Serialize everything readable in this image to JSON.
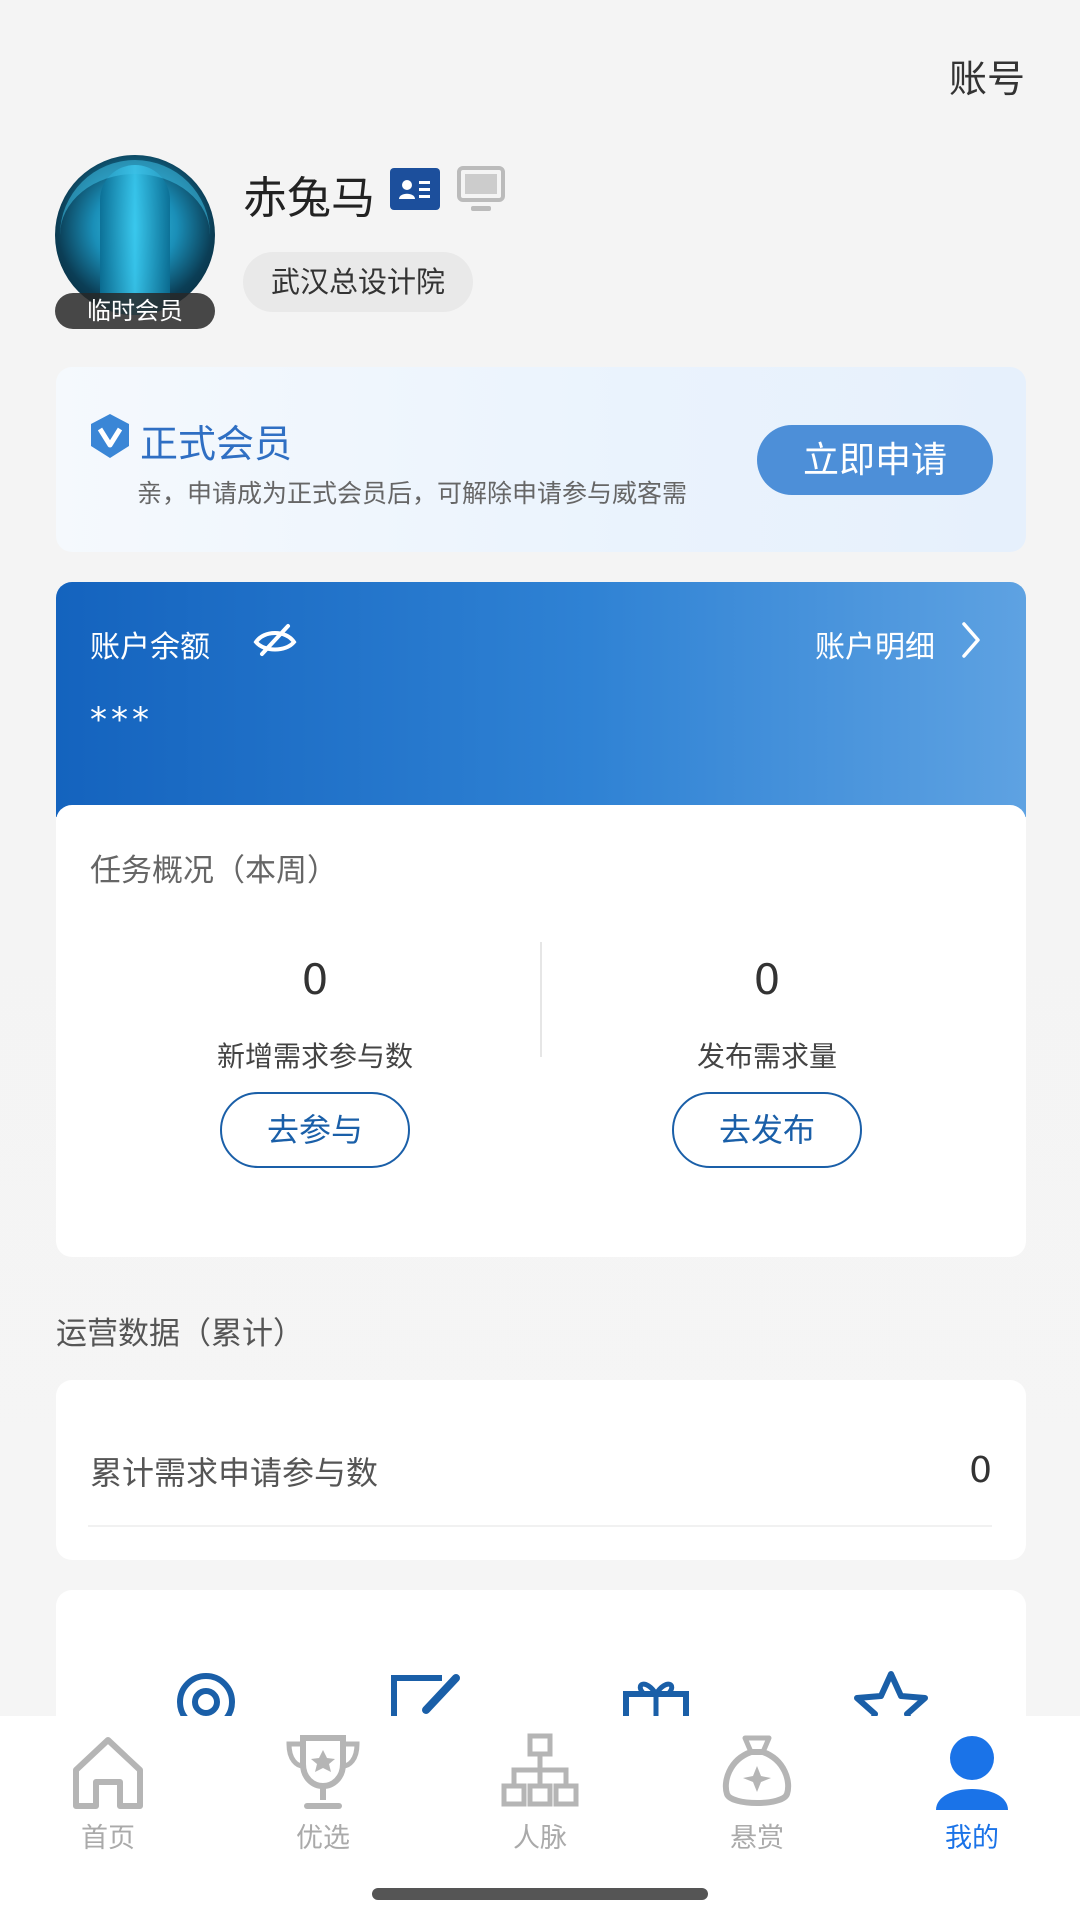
{
  "header": {
    "account_link": "账号"
  },
  "profile": {
    "name": "赤兔马",
    "member_tag": "临时会员",
    "organization": "武汉总设计院",
    "badges": [
      "id-card-icon",
      "computer-icon"
    ]
  },
  "membership": {
    "title": "正式会员",
    "description": "亲，申请成为正式会员后，可解除申请参与威客需",
    "apply_button": "立即申请"
  },
  "balance": {
    "label": "账户余额",
    "value": "***",
    "detail_link": "账户明细",
    "visibility_icon": "eye-hidden-icon"
  },
  "task_overview": {
    "title": "任务概况（本周）",
    "stats": [
      {
        "value": "0",
        "label": "新增需求参与数",
        "button": "去参与"
      },
      {
        "value": "0",
        "label": "发布需求量",
        "button": "去发布"
      }
    ]
  },
  "operations": {
    "title": "运营数据（累计）",
    "rows": [
      {
        "label": "累计需求申请参与数",
        "value": "0"
      }
    ]
  },
  "tools": {
    "icons": [
      "location-icon",
      "edit-icon",
      "gift-icon",
      "star-icon"
    ]
  },
  "bottom_nav": {
    "items": [
      {
        "label": "首页",
        "icon": "home-icon",
        "active": false
      },
      {
        "label": "优选",
        "icon": "trophy-icon",
        "active": false
      },
      {
        "label": "人脉",
        "icon": "network-icon",
        "active": false
      },
      {
        "label": "悬赏",
        "icon": "money-bag-icon",
        "active": false
      },
      {
        "label": "我的",
        "icon": "user-icon",
        "active": true
      }
    ]
  },
  "colors": {
    "accent": "#1a73e8",
    "brand_blue": "#1463be",
    "button_outline": "#1a5fa8"
  }
}
